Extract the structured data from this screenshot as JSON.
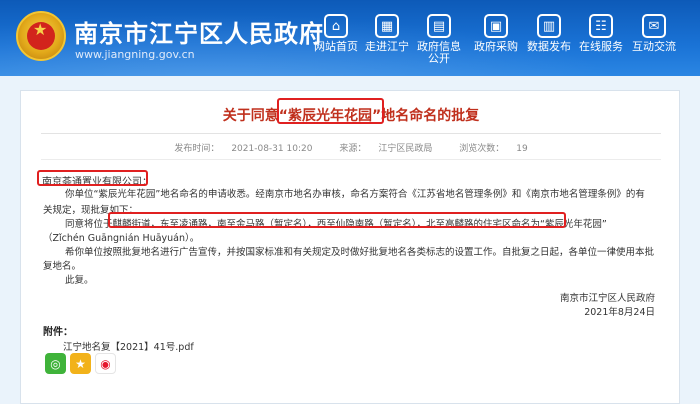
{
  "header": {
    "site_title": "南京市江宁区人民政府",
    "site_url": "www.jiangning.gov.cn",
    "nav": [
      {
        "label": "网站首页",
        "icon": "home-icon",
        "glyph": "⌂"
      },
      {
        "label": "走进江宁",
        "icon": "building-icon",
        "glyph": "▦"
      },
      {
        "label": "政府信息公开",
        "icon": "document-icon",
        "glyph": "▤"
      },
      {
        "label": "政府采购",
        "icon": "purchase-icon",
        "glyph": "▣"
      },
      {
        "label": "数据发布",
        "icon": "chart-icon",
        "glyph": "▥"
      },
      {
        "label": "在线服务",
        "icon": "service-icon",
        "glyph": "☷"
      },
      {
        "label": "互动交流",
        "icon": "chat-icon",
        "glyph": "✉"
      }
    ]
  },
  "article": {
    "title": "关于同意“紫辰光年花园”地名命名的批复",
    "publish_label": "发布时间：",
    "publish_time": "2021-08-31 10:20",
    "source_label": "来源：",
    "source": "江宁区民政局",
    "views_label": "浏览次数：",
    "views": "19",
    "addressee": "南京荟通置业有限公司：",
    "p1": "你单位“紫辰光年花园”地名命名的申请收悉。经南京市地名办审核，命名方案符合《江苏省地名管理条例》和《南京市地名管理条例》的有",
    "p1b": "关规定，现批复如下：",
    "p2": "同意将位于麒麟街道，东至凌通路，南至金马路（暂定名），西至仙隐南路（暂定名），北至高麟路的住宅区命名为“紫辰光年花园”",
    "p2b": "（Zǐchén Guāngnián Huāyuán）。",
    "p3": "希你单位按照批复地名进行广告宣传，并按国家标准和有关规定及时做好批复地名各类标志的设置工作。自批复之日起，各单位一律使用本批",
    "p3b": "复地名。",
    "p4": "此复。",
    "sign_org": "南京市江宁区人民政府",
    "sign_date": "2021年8月24日",
    "attach_label": "附件：",
    "attach_file": "江宁地名复【2021】41号.pdf"
  },
  "colors": {
    "header": "#1a73d6",
    "title_red": "#c0301d",
    "highlight_box": "#e02020"
  }
}
